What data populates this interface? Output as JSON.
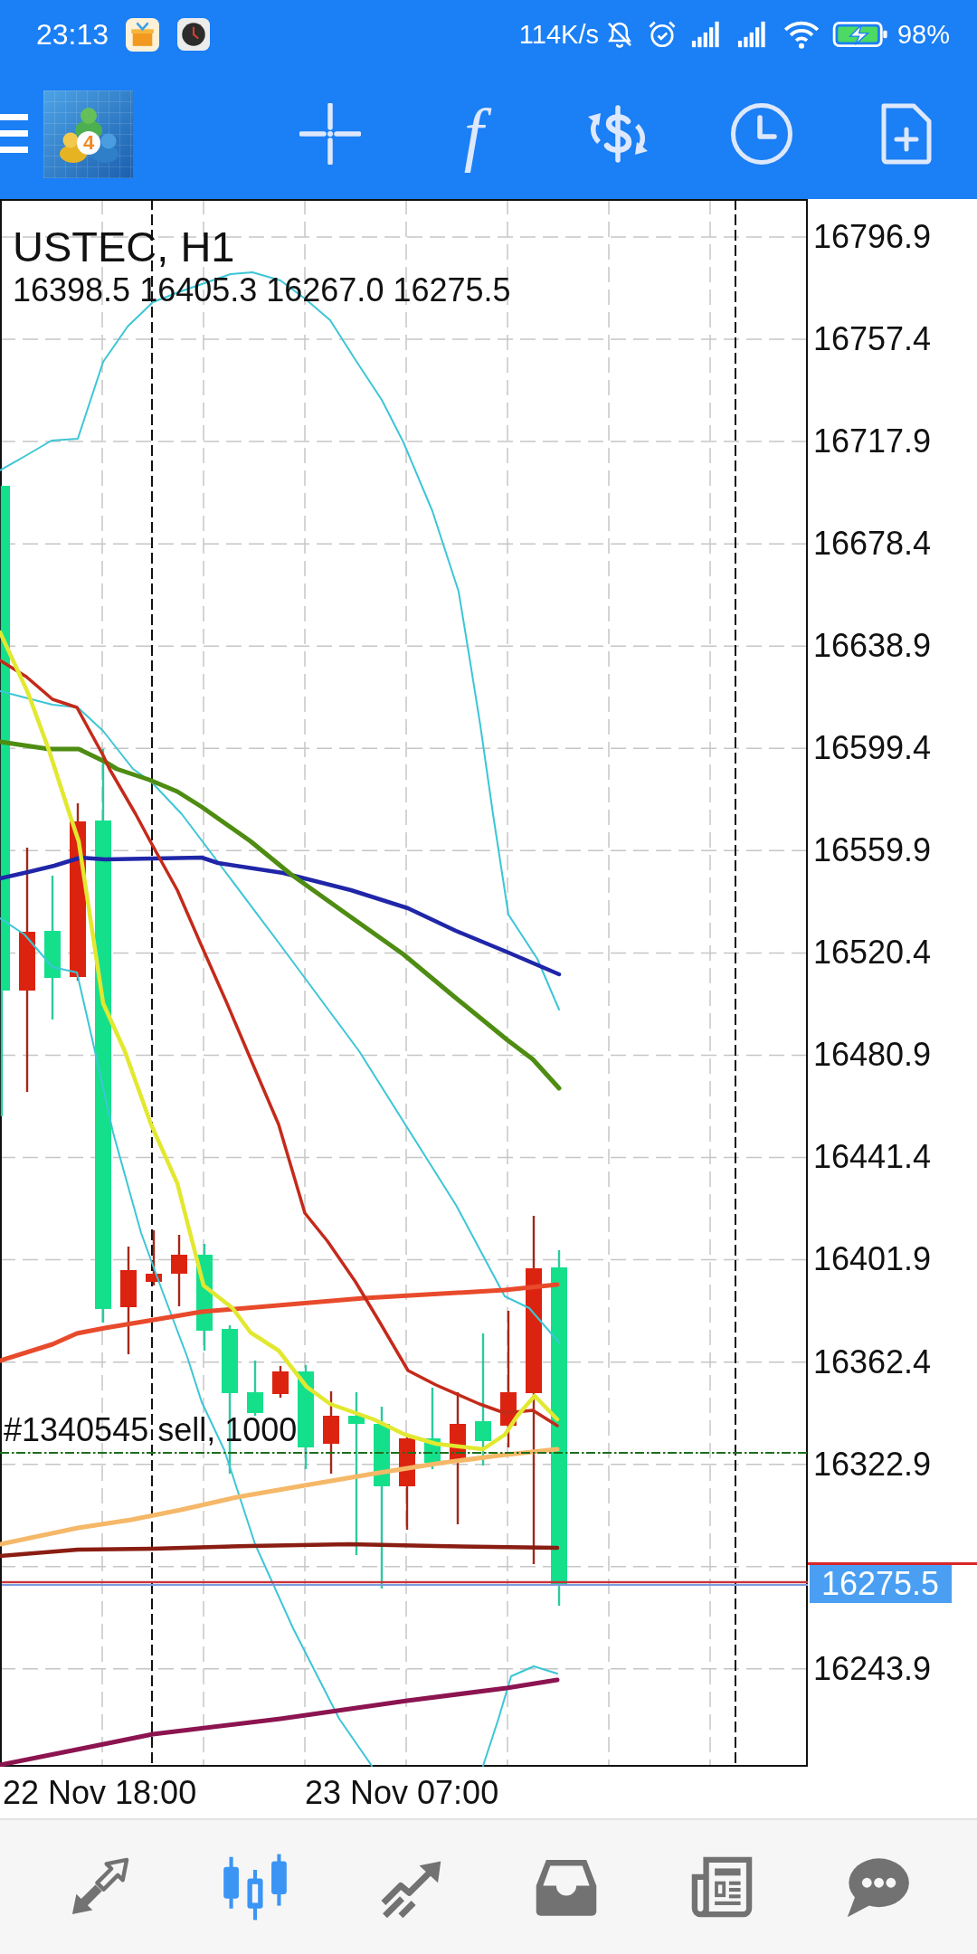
{
  "status_bar": {
    "time": "23:13",
    "network_speed": "114K/s",
    "battery": "98%"
  },
  "toolbar": {
    "logo_badge": "4",
    "function_button": "f"
  },
  "chart": {
    "symbol": "USTEC, H1",
    "ohlc": "16398.5 16405.3 16267.0 16275.5",
    "order_label": "#1340545 sell, 1000",
    "price_axis": {
      "labels": [
        "16796.9",
        "16757.4",
        "16717.9",
        "16678.4",
        "16638.9",
        "16599.4",
        "16559.9",
        "16520.4",
        "16480.9",
        "16441.4",
        "16401.9",
        "16362.4",
        "16322.9"
      ],
      "current_price": "16275.5",
      "labels_below": [
        "16243.9"
      ]
    },
    "time_axis": [
      "22 Nov 18:00",
      "23 Nov 07:00"
    ]
  },
  "bottom_nav": [
    {
      "kind": "quotes",
      "selected": false
    },
    {
      "kind": "chart",
      "selected": true
    },
    {
      "kind": "trade",
      "selected": false
    },
    {
      "kind": "history",
      "selected": false
    },
    {
      "kind": "news",
      "selected": false
    },
    {
      "kind": "chat",
      "selected": false
    }
  ]
}
